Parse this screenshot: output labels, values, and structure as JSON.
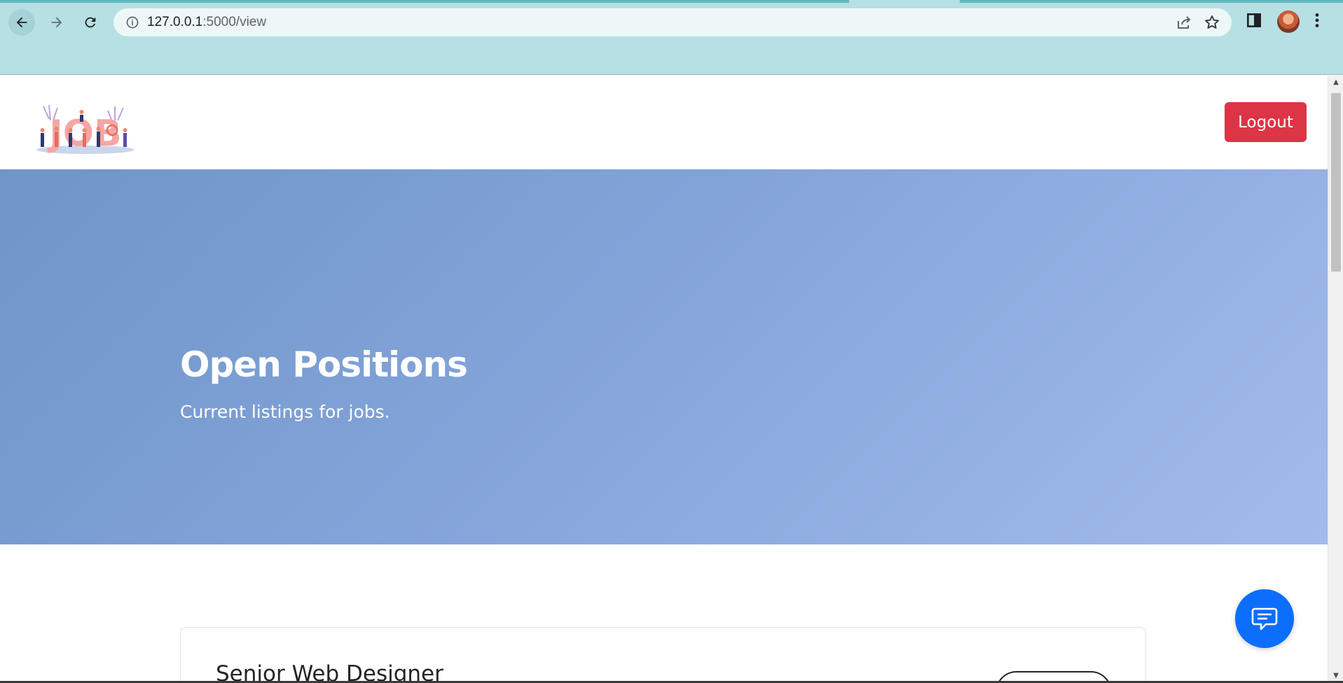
{
  "browser": {
    "url_host": "127.0.0.1",
    "url_rest": ":5000/view",
    "icons": {
      "back": "arrow-left-icon",
      "forward": "arrow-right-icon",
      "reload": "reload-icon",
      "site_info": "info-icon",
      "share": "share-icon",
      "bookmark": "star-icon",
      "side_panel": "side-panel-icon",
      "profile": "avatar",
      "menu": "kebab-menu-icon"
    }
  },
  "header": {
    "logo": "JOB",
    "logout_label": "Logout"
  },
  "hero": {
    "title": "Open Positions",
    "subtitle": "Current listings for jobs."
  },
  "jobs": [
    {
      "title": "Senior Web Designer"
    }
  ],
  "chat": {
    "icon": "chat-icon"
  },
  "colors": {
    "chrome_bg": "#b7e0e4",
    "logout": "#dc3545",
    "hero_start": "#6f95c8",
    "hero_end": "#a3bbec",
    "chat_fab": "#0d6efd"
  }
}
